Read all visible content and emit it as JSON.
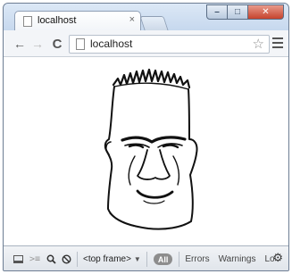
{
  "tab": {
    "title": "localhost",
    "close": "×"
  },
  "window_controls": {
    "minimize": "–",
    "maximize": "□",
    "close": "✕"
  },
  "toolbar": {
    "back": "←",
    "forward": "→",
    "reload": "C",
    "url": "localhost",
    "bookmark": "☆",
    "menu_icon": "hamburger-menu-icon"
  },
  "content": {
    "image": "sketch of a grimacing face"
  },
  "devtools": {
    "frame_selector": "<top frame>",
    "filters": [
      "All",
      "Errors",
      "Warnings",
      "Lo"
    ],
    "icons": [
      "dock-icon",
      "console-icon",
      "search-icon",
      "clear-icon",
      "gear-icon"
    ]
  }
}
